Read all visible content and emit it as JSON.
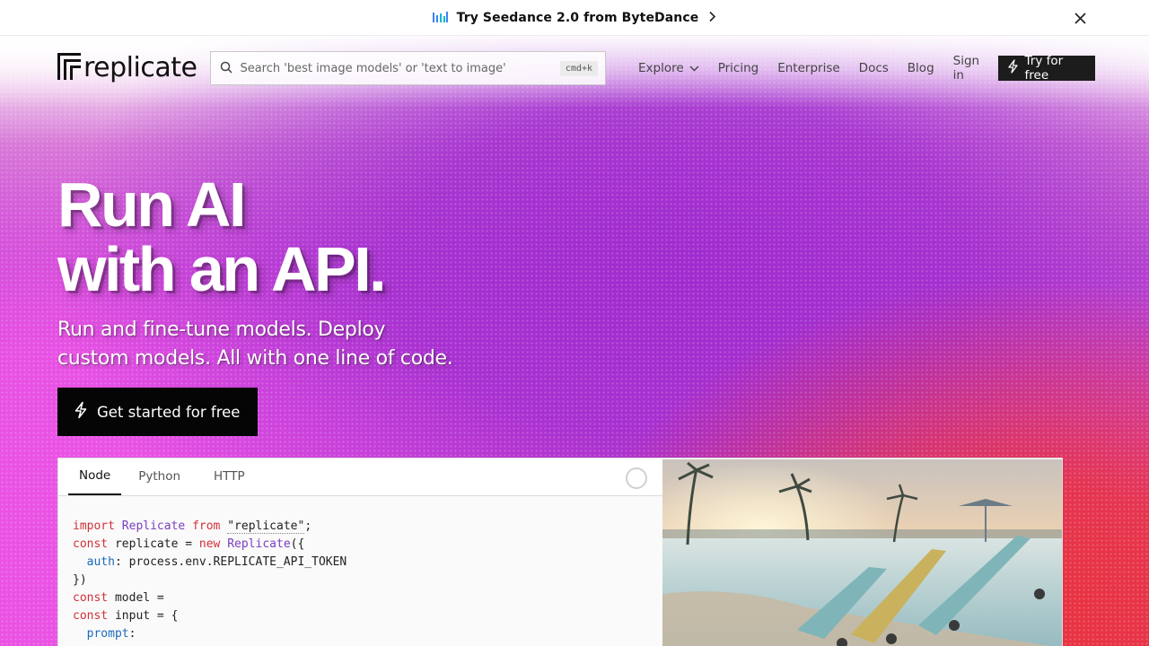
{
  "banner": {
    "text": "Try Seedance 2.0 from ByteDance",
    "icon": "bar-chart-icon",
    "close_icon": "close-icon"
  },
  "nav": {
    "logo_text": "replicate",
    "search_placeholder": "Search 'best image models' or 'text to image'",
    "search_shortcut": "cmd+k",
    "links": {
      "explore": "Explore",
      "pricing": "Pricing",
      "enterprise": "Enterprise",
      "docs": "Docs",
      "blog": "Blog",
      "signin": "Sign in"
    },
    "try_label": "Try for free"
  },
  "hero": {
    "headline_line1": "Run AI",
    "headline_line2": "with an API.",
    "sub_line1": "Run and fine-tune models. Deploy",
    "sub_line2": "custom models. All with one line of code.",
    "cta_label": "Get started for free"
  },
  "code_panel": {
    "tabs": [
      "Node",
      "Python",
      "HTTP"
    ],
    "active_tab": "Node",
    "code": {
      "l1_kw1": "import",
      "l1_cls": "Replicate",
      "l1_kw2": "from",
      "l1_str": "\"replicate\"",
      "l1_end": ";",
      "l2_kw1": "const",
      "l2_mid": " replicate = ",
      "l2_kw2": "new",
      "l2_cls": "Replicate",
      "l2_end": "({",
      "l3_prop": "auth",
      "l3_end": ": process.env.REPLICATE_API_TOKEN",
      "l4": "})",
      "l5_kw": "const",
      "l5_end": " model =",
      "l6_kw": "const",
      "l6_end": " input = {",
      "l7_prop": "prompt",
      "l7_end": ":"
    }
  },
  "colors": {
    "brand_dark": "#111111",
    "hero_pink": "#ea52e6",
    "hero_purple": "#a02ccf",
    "hero_red": "#e8323f",
    "code_keyword": "#d2303a",
    "code_class": "#7a3fc0",
    "code_property": "#1a6ab8"
  }
}
